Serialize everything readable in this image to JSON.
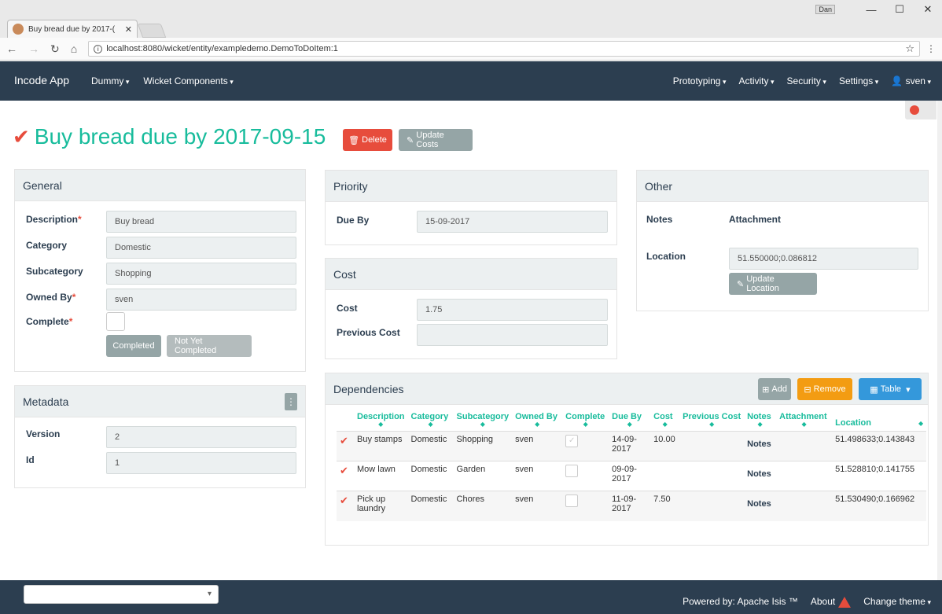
{
  "browser": {
    "tab_title": "Buy bread due by 2017-(",
    "url": "localhost:8080/wicket/entity/exampledemo.DemoToDoItem:1",
    "user_badge": "Dan"
  },
  "navbar": {
    "brand": "Incode App",
    "left": [
      "Dummy",
      "Wicket Components"
    ],
    "right": [
      "Prototyping",
      "Activity",
      "Security",
      "Settings",
      "sven"
    ]
  },
  "header": {
    "title": "Buy bread due by 2017-09-15",
    "delete_label": "Delete",
    "update_costs_label": "Update Costs"
  },
  "general": {
    "title": "General",
    "description_label": "Description",
    "description": "Buy bread",
    "category_label": "Category",
    "category": "Domestic",
    "subcategory_label": "Subcategory",
    "subcategory": "Shopping",
    "owned_by_label": "Owned By",
    "owned_by": "sven",
    "complete_label": "Complete",
    "completed_btn": "Completed",
    "not_completed_btn": "Not Yet Completed"
  },
  "metadata": {
    "title": "Metadata",
    "version_label": "Version",
    "version": "2",
    "id_label": "Id",
    "id": "1"
  },
  "priority": {
    "title": "Priority",
    "due_by_label": "Due By",
    "due_by": "15-09-2017"
  },
  "cost": {
    "title": "Cost",
    "cost_label": "Cost",
    "cost": "1.75",
    "previous_cost_label": "Previous Cost",
    "previous_cost": ""
  },
  "other": {
    "title": "Other",
    "notes_label": "Notes",
    "attachment_label": "Attachment",
    "location_label": "Location",
    "location": "51.550000;0.086812",
    "update_location_btn": "Update Location"
  },
  "dependencies": {
    "title": "Dependencies",
    "add_btn": "Add",
    "remove_btn": "Remove",
    "table_btn": "Table",
    "columns": [
      "Description",
      "Category",
      "Subcategory",
      "Owned By",
      "Complete",
      "Due By",
      "Cost",
      "Previous Cost",
      "Notes",
      "Attachment",
      "Location"
    ],
    "rows": [
      {
        "description": "Buy stamps",
        "category": "Domestic",
        "subcategory": "Shopping",
        "owned_by": "sven",
        "complete": true,
        "due_by": "14-09-2017",
        "cost": "10.00",
        "previous_cost": "",
        "notes": "Notes",
        "attachment": "",
        "location": "51.498633;0.143843"
      },
      {
        "description": "Mow lawn",
        "category": "Domestic",
        "subcategory": "Garden",
        "owned_by": "sven",
        "complete": false,
        "due_by": "09-09-2017",
        "cost": "",
        "previous_cost": "",
        "notes": "Notes",
        "attachment": "",
        "location": "51.528810;0.141755"
      },
      {
        "description": "Pick up laundry",
        "category": "Domestic",
        "subcategory": "Chores",
        "owned_by": "sven",
        "complete": false,
        "due_by": "11-09-2017",
        "cost": "7.50",
        "previous_cost": "",
        "notes": "Notes",
        "attachment": "",
        "location": "51.530490;0.166962"
      }
    ]
  },
  "footer": {
    "powered_by": "Powered by:",
    "apache_isis": "Apache Isis ™",
    "about": "About",
    "change_theme": "Change theme"
  },
  "colors": {
    "navbar": "#2c3e50",
    "accent": "#18bc9c",
    "danger": "#e74c3c",
    "warning": "#f39c12",
    "info": "#3498db"
  }
}
